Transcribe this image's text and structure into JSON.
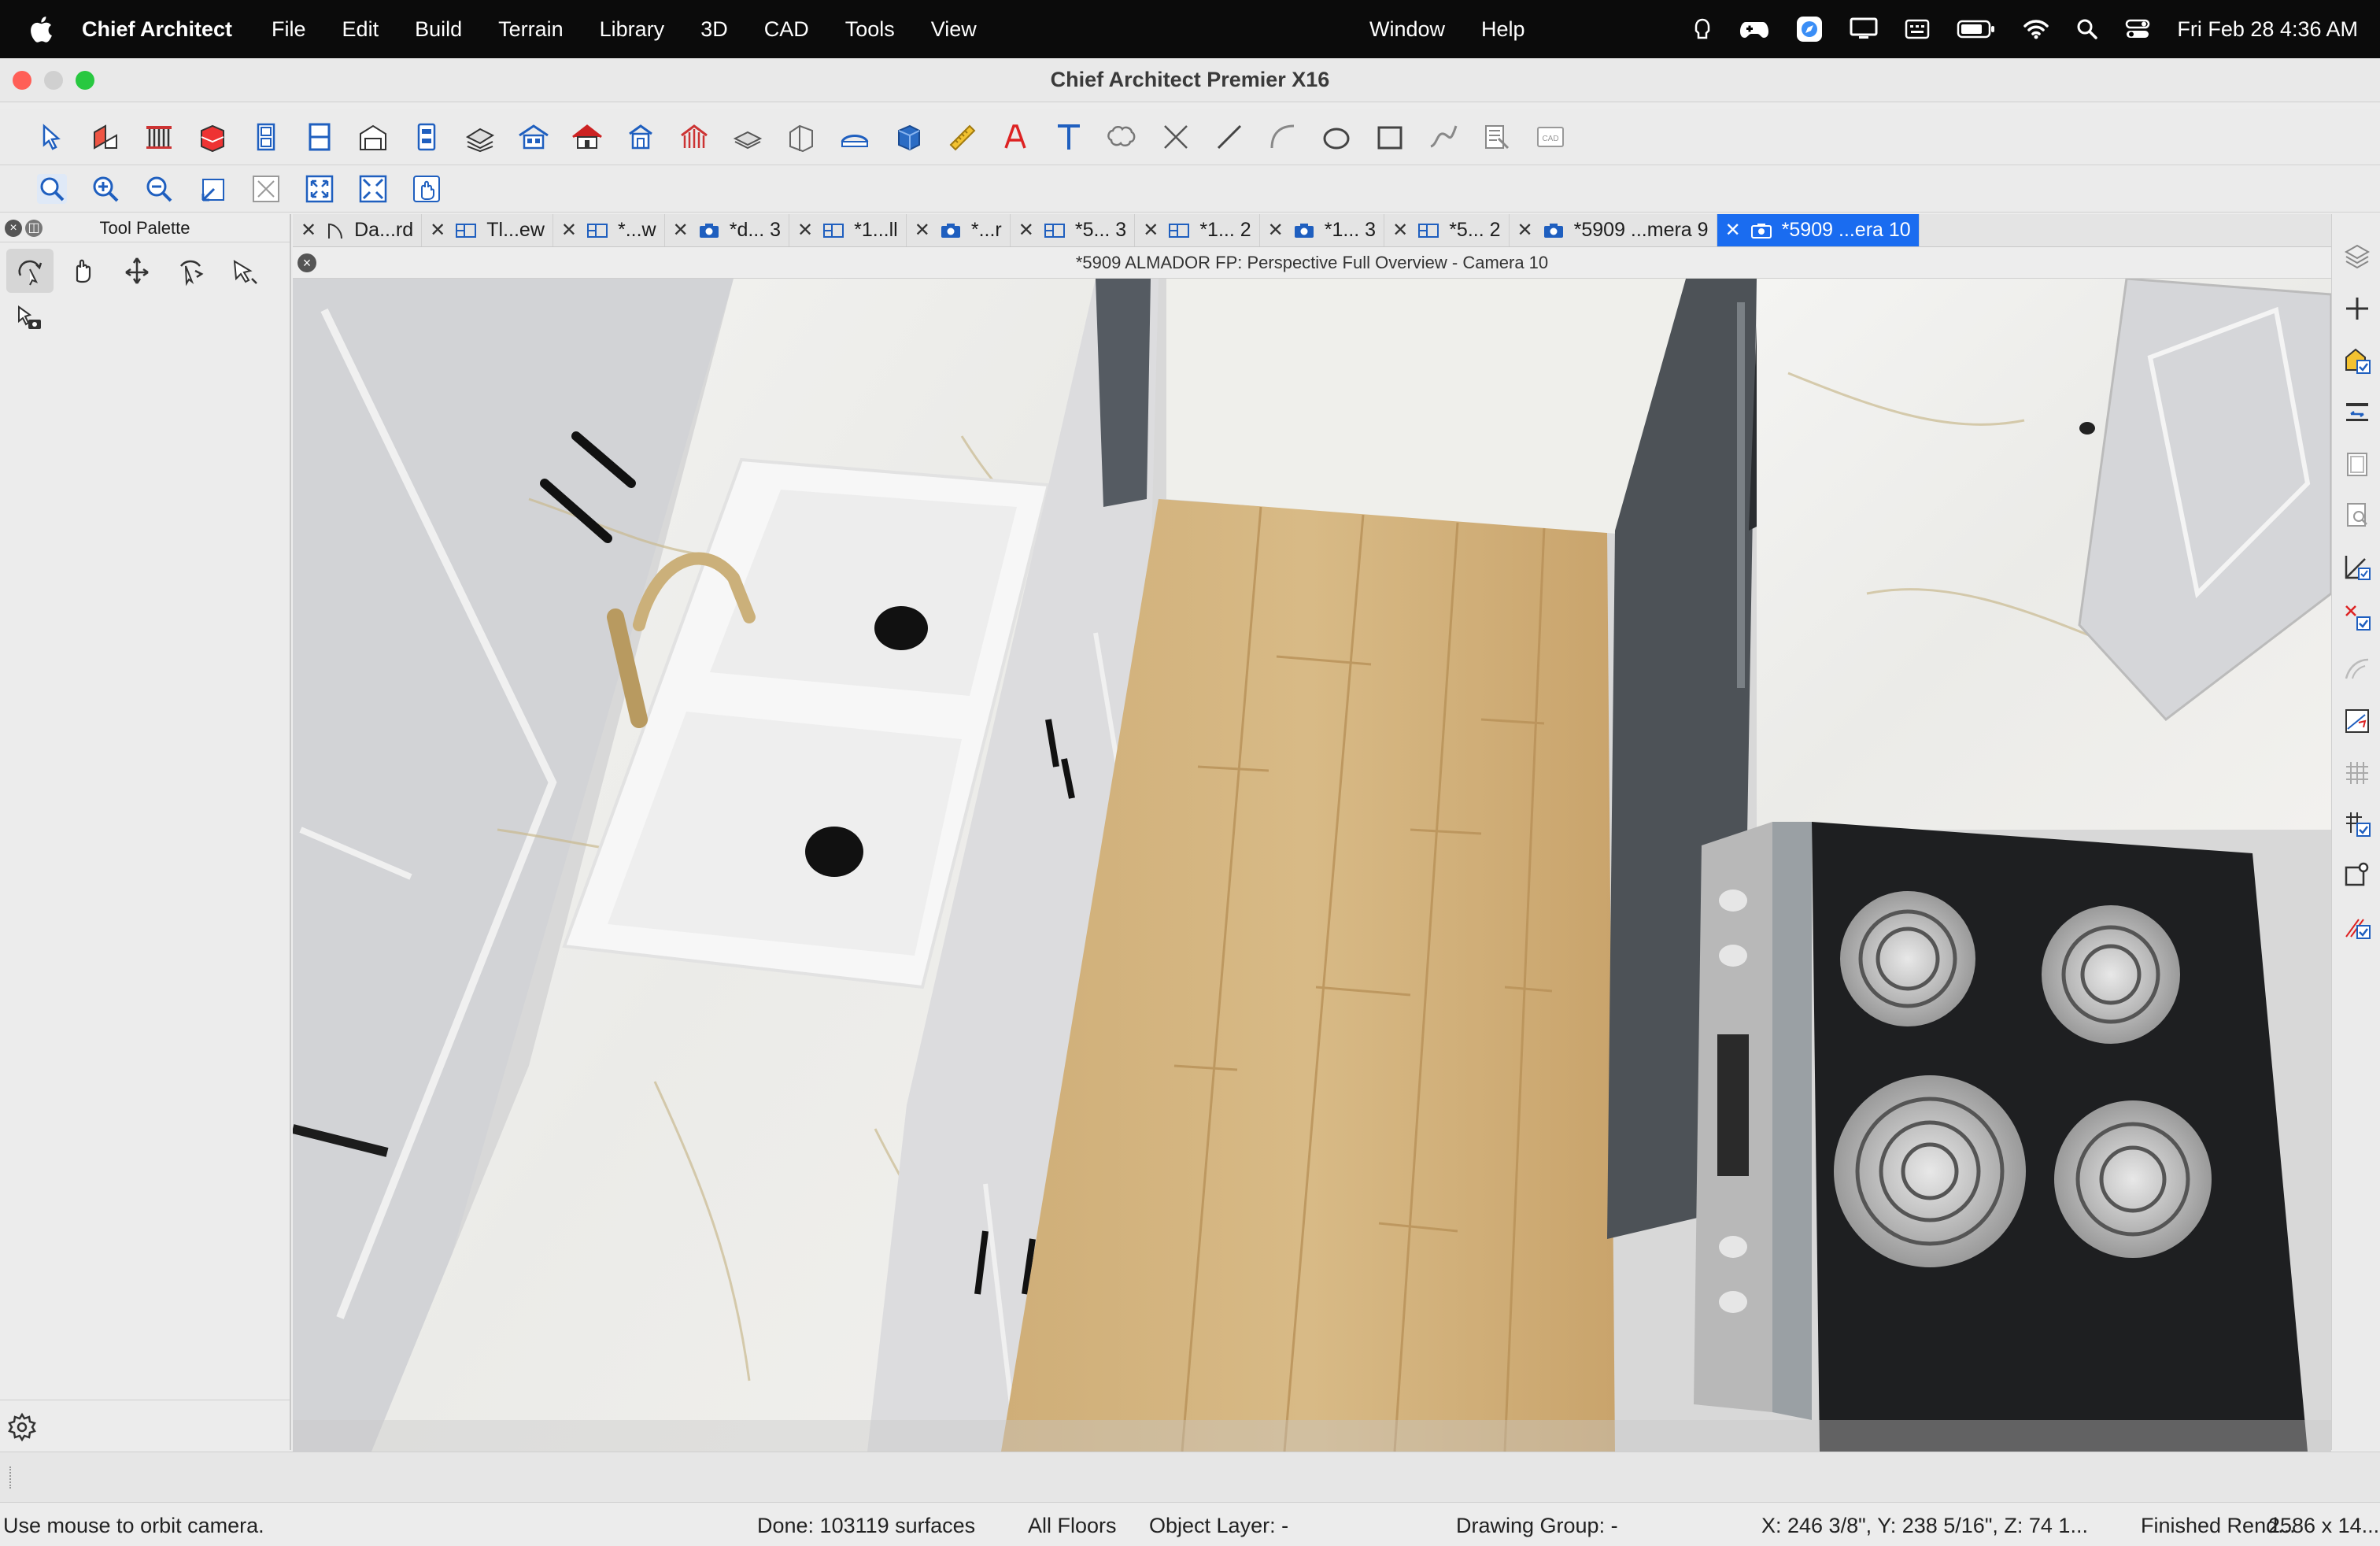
{
  "menubar": {
    "app_name": "Chief Architect",
    "items": [
      "File",
      "Edit",
      "Build",
      "Terrain",
      "Library",
      "3D",
      "CAD",
      "Tools",
      "View"
    ],
    "right_items": [
      "Window",
      "Help"
    ],
    "clock": "Fri Feb 28  4:36 AM"
  },
  "window": {
    "title": "Chief Architect Premier X16"
  },
  "palette": {
    "title": "Tool Palette"
  },
  "tabs": [
    {
      "label": "Da...rd",
      "icon": "elevation-icon"
    },
    {
      "label": "Tl...ew",
      "icon": "plan-view-icon"
    },
    {
      "label": "*...w",
      "icon": "plan-view-icon"
    },
    {
      "label": "*d... 3",
      "icon": "camera-icon"
    },
    {
      "label": "*1...ll",
      "icon": "plan-view-icon"
    },
    {
      "label": "*...r",
      "icon": "camera-icon"
    },
    {
      "label": "*5... 3",
      "icon": "plan-view-icon"
    },
    {
      "label": "*1... 2",
      "icon": "plan-view-icon"
    },
    {
      "label": "*1... 3",
      "icon": "camera-icon"
    },
    {
      "label": "*5... 2",
      "icon": "plan-view-icon"
    },
    {
      "label": "*5909 ...mera 9",
      "icon": "camera-icon"
    },
    {
      "label": "*5909 ...era 10",
      "icon": "camera-icon",
      "active": true
    }
  ],
  "view": {
    "title": "*5909 ALMADOR FP: Perspective Full Overview - Camera 10"
  },
  "status": {
    "message": "Use mouse to orbit camera.",
    "done": "Done:  103119 surfaces",
    "floors": "All Floors",
    "object_layer": "Object Layer: -",
    "drawing_group": "Drawing Group: -",
    "coords": "X: 246 3/8\", Y: 238 5/16\", Z: 74 1...",
    "render": "Finished Rend...",
    "resolution": "2586 x 14..."
  },
  "colors": {
    "accent": "#1a6cf0",
    "menubar": "#0b0b0b",
    "toolbar": "#ebebeb"
  }
}
